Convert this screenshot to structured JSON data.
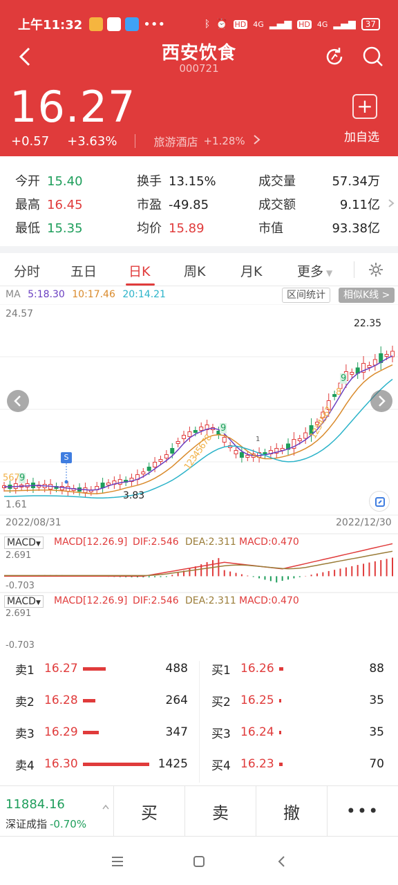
{
  "status": {
    "time": "上午11:32",
    "battery": "37",
    "net1": "4G",
    "net2": "4G",
    "hd1": "HD",
    "hd2": "HD",
    "more": "•••"
  },
  "header": {
    "title": "西安饮食",
    "code": "000721",
    "price": "16.27",
    "change": "+0.57",
    "change_pct": "+3.63%",
    "industry": "旅游酒店",
    "industry_pct": "+1.28%",
    "add_label": "加自选",
    "accent": "#e03b3b"
  },
  "stats": {
    "open_label": "今开",
    "open": "15.40",
    "turnover_label": "换手",
    "turnover": "13.15%",
    "volume_label": "成交量",
    "volume": "57.34万",
    "high_label": "最高",
    "high": "16.45",
    "pe_label": "市盈",
    "pe": "-49.85",
    "amount_label": "成交额",
    "amount": "9.11亿",
    "low_label": "最低",
    "low": "15.35",
    "avg_label": "均价",
    "avg": "15.89",
    "mcap_label": "市值",
    "mcap": "93.38亿"
  },
  "tabs": {
    "t1": "分时",
    "t2": "五日",
    "t3": "日K",
    "t4": "周K",
    "t5": "月K",
    "more": "更多"
  },
  "ma": {
    "label": "MA",
    "ma5": "5:18.30",
    "ma10": "10:17.46",
    "ma20": "20:14.21",
    "btn1": "区间统计",
    "btn2": "相似K线 >"
  },
  "kchart": {
    "ymax": "24.57",
    "ymin": "1.61",
    "hi_label": "22.35",
    "lo_label": "3.83",
    "start_date": "2022/08/31",
    "end_date": "2022/12/30",
    "marker": "S",
    "seq_left": "5678",
    "seq_left_nine": "9",
    "seq_mid": "12345678",
    "seq_mid_nine": "9",
    "seq_right": "1234567",
    "seq_right_eight": "8",
    "seq_right_nine": "9",
    "dot": "1"
  },
  "macd1": {
    "sel": "MACD",
    "text": "MACD[12.26.9]",
    "dif": "DIF:2.546",
    "dea": "DEA:2.311",
    "macd": "MACD:0.470",
    "ymax": "2.691",
    "ymin": "-0.703"
  },
  "macd2": {
    "sel": "MACD",
    "text": "MACD[12.26.9]",
    "dif": "DIF:2.546",
    "dea": "DEA:2.311",
    "macd": "MACD:0.470",
    "ymax": "2.691",
    "ymin": "-0.703"
  },
  "book": {
    "sells": [
      {
        "label": "卖1",
        "price": "16.27",
        "vol": "488"
      },
      {
        "label": "卖2",
        "price": "16.28",
        "vol": "264"
      },
      {
        "label": "卖3",
        "price": "16.29",
        "vol": "347"
      },
      {
        "label": "卖4",
        "price": "16.30",
        "vol": "1425"
      }
    ],
    "buys": [
      {
        "label": "买1",
        "price": "16.26",
        "vol": "88"
      },
      {
        "label": "买2",
        "price": "16.25",
        "vol": "35"
      },
      {
        "label": "买3",
        "price": "16.24",
        "vol": "35"
      },
      {
        "label": "买4",
        "price": "16.23",
        "vol": "70"
      }
    ]
  },
  "bottom": {
    "index_value": "11884.16",
    "index_name": "深证成指",
    "index_pct": "-0.70%",
    "buy": "买",
    "sell": "卖",
    "cancel": "撤",
    "more": "•••"
  }
}
